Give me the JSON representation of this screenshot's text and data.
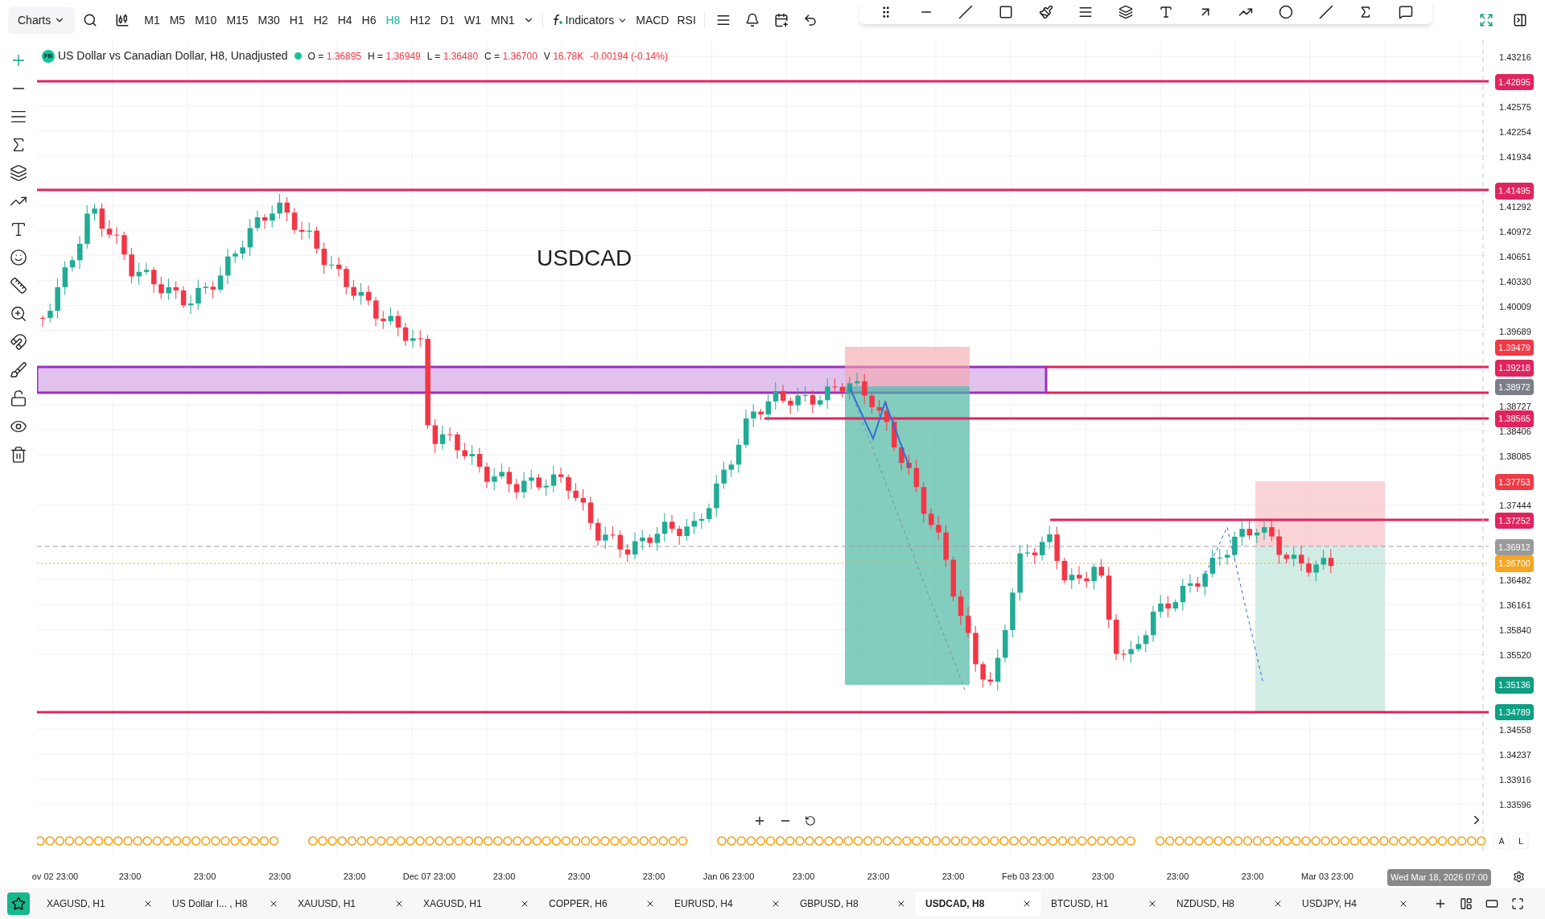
{
  "toolbar": {
    "charts_menu": "Charts",
    "timeframes": [
      {
        "label": "M1",
        "selected": false
      },
      {
        "label": "M5",
        "selected": false
      },
      {
        "label": "M10",
        "selected": false
      },
      {
        "label": "M15",
        "selected": false
      },
      {
        "label": "M30",
        "selected": false
      },
      {
        "label": "H1",
        "selected": false
      },
      {
        "label": "H2",
        "selected": false
      },
      {
        "label": "H4",
        "selected": false
      },
      {
        "label": "H6",
        "selected": false
      },
      {
        "label": "H8",
        "selected": true
      },
      {
        "label": "H12",
        "selected": false
      },
      {
        "label": "D1",
        "selected": false
      },
      {
        "label": "W1",
        "selected": false
      },
      {
        "label": "MN1",
        "selected": false
      }
    ],
    "indicators": "Indicators",
    "studies": [
      "MACD",
      "RSI"
    ]
  },
  "legend": {
    "badge": "FB",
    "title": "US Dollar vs Canadian Dollar, H8, Unadjusted",
    "ohlc": [
      {
        "label": "O =",
        "value": "1.36895"
      },
      {
        "label": "H =",
        "value": "1.36949"
      },
      {
        "label": "L =",
        "value": "1.36480"
      },
      {
        "label": "C =",
        "value": "1.36700"
      },
      {
        "label": "V",
        "value": "16.78K"
      }
    ],
    "change": "-0.00194 (-0.14%)"
  },
  "chart": {
    "title": "USDCAD"
  },
  "price_axis": {
    "ticks": [
      "1.43216",
      "1.42575",
      "1.42254",
      "1.41934",
      "1.41292",
      "1.40972",
      "1.40651",
      "1.40330",
      "1.40009",
      "1.39689",
      "1.38727",
      "1.38406",
      "1.38085",
      "1.37444",
      "1.36482",
      "1.36161",
      "1.35840",
      "1.35520",
      "1.34558",
      "1.34237",
      "1.33916",
      "1.33596"
    ],
    "tags": [
      {
        "price": "1.42895",
        "color": "#e0245e"
      },
      {
        "price": "1.41495",
        "color": "#e0245e"
      },
      {
        "price": "1.39479",
        "color": "#f03a47"
      },
      {
        "price": "1.39218",
        "color": "#e0245e"
      },
      {
        "price": "1.38972",
        "color": "#7c7f88"
      },
      {
        "price": "1.38565",
        "color": "#e0245e"
      },
      {
        "price": "1.37753",
        "color": "#f03a47"
      },
      {
        "price": "1.37252",
        "color": "#e0245e"
      },
      {
        "price": "1.36912",
        "color": "#9a9a9a"
      },
      {
        "price": "1.36700",
        "color": "#f5a623"
      },
      {
        "price": "1.35136",
        "color": "#0e9f83"
      },
      {
        "price": "1.34789",
        "color": "#0e9f83"
      }
    ],
    "scale_buttons": [
      "A",
      "L"
    ]
  },
  "time_axis": {
    "labels": [
      "ov 02 23:00",
      "23:00",
      "23:00",
      "23:00",
      "23:00",
      "Dec 07 23:00",
      "23:00",
      "23:00",
      "23:00",
      "Jan 06 23:00",
      "23:00",
      "23:00",
      "23:00",
      "Feb 03 23:00",
      "23:00",
      "23:00",
      "23:00",
      "Mar 03 23:00"
    ],
    "cursor_date": "Wed Mar 18, 2026 07:00"
  },
  "tabs": [
    {
      "label": "XAGUSD, H1",
      "selected": false
    },
    {
      "label": "US Dollar I... , H8",
      "selected": false
    },
    {
      "label": "XAUUSD, H1",
      "selected": false
    },
    {
      "label": "XAGUSD, H1",
      "selected": false
    },
    {
      "label": "COPPER, H6",
      "selected": false
    },
    {
      "label": "EURUSD, H4",
      "selected": false
    },
    {
      "label": "GBPUSD, H8",
      "selected": false
    },
    {
      "label": "USDCAD, H8",
      "selected": true
    },
    {
      "label": "BTCUSD, H1",
      "selected": false
    },
    {
      "label": "NZDUSD, H8",
      "selected": false
    },
    {
      "label": "USDJPY, H4",
      "selected": false
    }
  ]
}
